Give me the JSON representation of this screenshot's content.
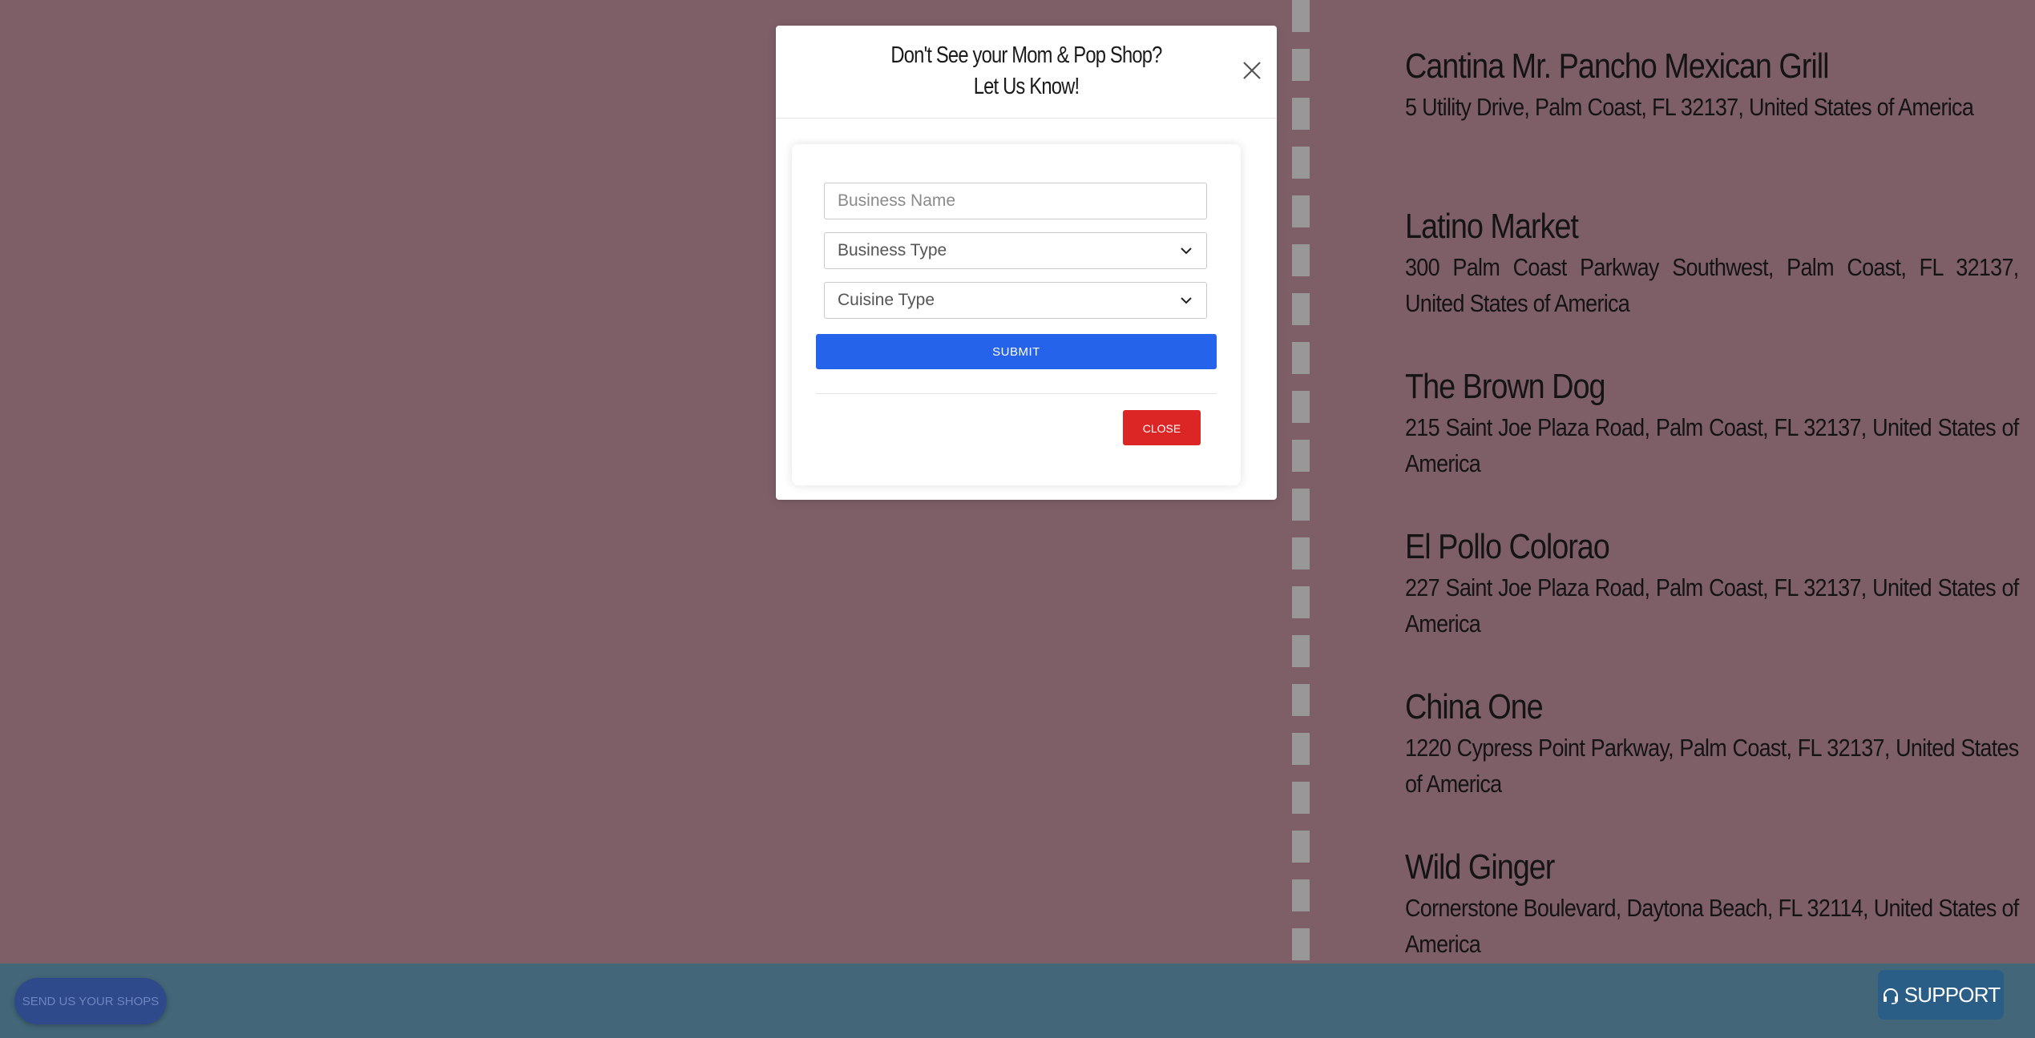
{
  "modal": {
    "title_line1": "Don't See your Mom & Pop Shop?",
    "title_line2": "Let Us Know!",
    "close_icon": "close-icon",
    "form": {
      "business_name_placeholder": "Business Name",
      "business_type_value": "Business Type",
      "cuisine_type_value": "Cuisine Type",
      "submit_label": "SUBMIT",
      "close_label": "CLOSE"
    }
  },
  "shops": [
    {
      "name": "Cantina Mr. Pancho Mexican Grill",
      "address": "5 Utility Drive, Palm Coast, FL 32137, United States of America"
    },
    {
      "name": "Latino Market",
      "address": "300 Palm Coast Parkway Southwest, Palm Coast, FL 32137, United States of America"
    },
    {
      "name": "The Brown Dog",
      "address": "215 Saint Joe Plaza Road, Palm Coast, FL 32137, United States of America"
    },
    {
      "name": "El Pollo Colorao",
      "address": "227 Saint Joe Plaza Road, Palm Coast, FL 32137, United States of America"
    },
    {
      "name": "China One",
      "address": "1220 Cypress Point Parkway, Palm Coast, FL 32137, United States of America"
    },
    {
      "name": "Wild Ginger",
      "address": "Cornerstone Boulevard, Daytona Beach, FL 32114, United States of America"
    }
  ],
  "footer": {
    "send_shops_label": "SEND US YOUR SHOPS",
    "support_label": "SUPPORT",
    "support_icon": "headset-icon"
  },
  "colors": {
    "page_background": "#7e5f67",
    "footer_background": "#436678",
    "submit_blue": "#2563eb",
    "close_red": "#dc2626",
    "support_button": "#2b5e87",
    "send_shops_button": "#2f4a8a"
  }
}
